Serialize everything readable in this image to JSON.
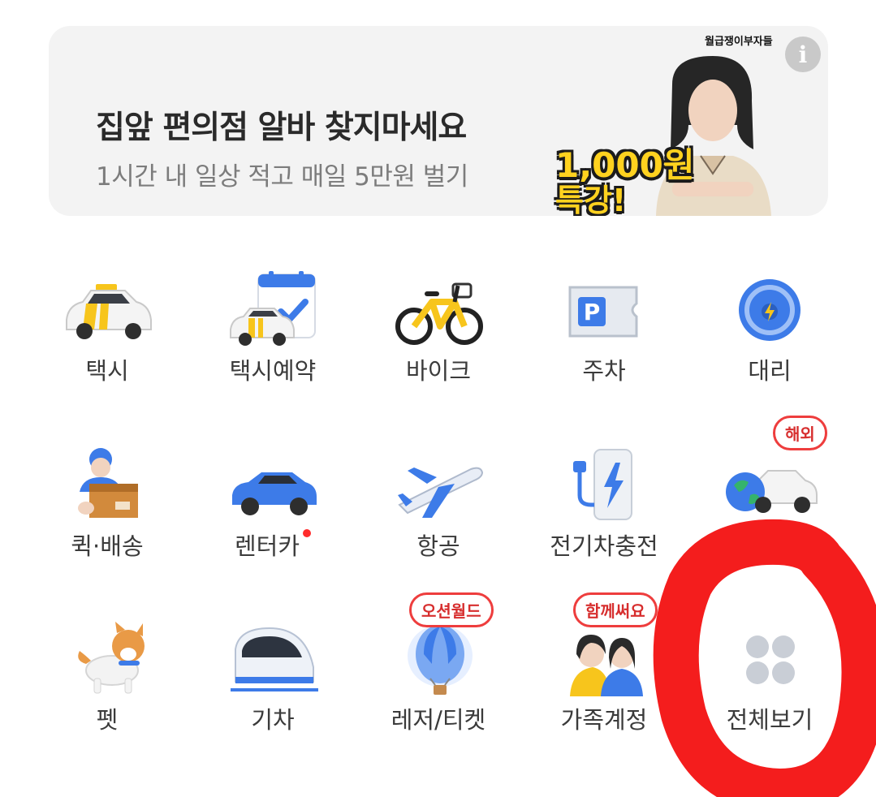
{
  "banner": {
    "title": "집앞 편의점 알바 찾지마세요",
    "subtitle": "1시간 내 일상 적고 매일 5만원 벌기",
    "brand": "월급쟁이부자들",
    "promo_line1": "1,000원",
    "promo_line2": "특강!",
    "info_icon": "i"
  },
  "menu": [
    {
      "label": "택시",
      "icon": "taxi-icon"
    },
    {
      "label": "택시예약",
      "icon": "taxi-reservation-icon"
    },
    {
      "label": "바이크",
      "icon": "bike-icon"
    },
    {
      "label": "주차",
      "icon": "parking-icon"
    },
    {
      "label": "대리",
      "icon": "designated-driver-icon"
    },
    {
      "label": "퀵·배송",
      "icon": "quick-delivery-icon"
    },
    {
      "label": "렌터카",
      "icon": "rental-car-icon",
      "new_dot": true
    },
    {
      "label": "항공",
      "icon": "airplane-icon"
    },
    {
      "label": "전기차충전",
      "icon": "ev-charging-icon"
    },
    {
      "label": "",
      "icon": "global-car-icon",
      "badge": "해외"
    },
    {
      "label": "펫",
      "icon": "pet-icon"
    },
    {
      "label": "기차",
      "icon": "train-icon"
    },
    {
      "label": "레저/티켓",
      "icon": "leisure-ticket-icon",
      "badge": "오션월드"
    },
    {
      "label": "가족계정",
      "icon": "family-account-icon",
      "badge": "함께써요"
    },
    {
      "label": "전체보기",
      "icon": "view-all-icon"
    }
  ],
  "colors": {
    "banner_bg": "#f3f3f3",
    "badge_red": "#ee3d3d",
    "annotation_red": "#f41d1d",
    "taxi_yellow": "#f7c51c",
    "brand_blue": "#3d7be8"
  }
}
